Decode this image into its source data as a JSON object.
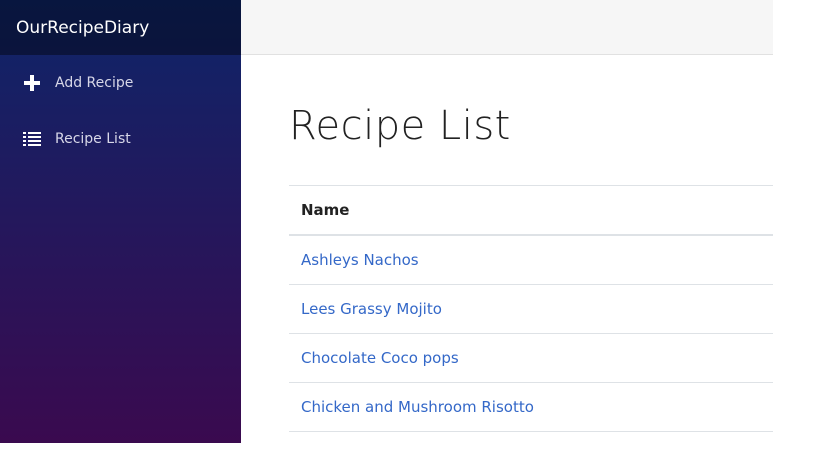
{
  "app": {
    "brand": "OurRecipeDiary"
  },
  "sidebar": {
    "items": [
      {
        "label": "Add Recipe",
        "icon": "plus-icon"
      },
      {
        "label": "Recipe List",
        "icon": "list-icon"
      }
    ]
  },
  "main": {
    "title": "Recipe List",
    "table": {
      "columns": [
        "Name"
      ],
      "rows": [
        "Ashleys Nachos",
        "Lees Grassy Mojito",
        "Chocolate Coco pops",
        "Chicken and Mushroom Risotto"
      ]
    }
  },
  "colors": {
    "sidebar_top": "#0e2569",
    "sidebar_bottom": "#3a0a4f",
    "link": "#3468c8"
  }
}
